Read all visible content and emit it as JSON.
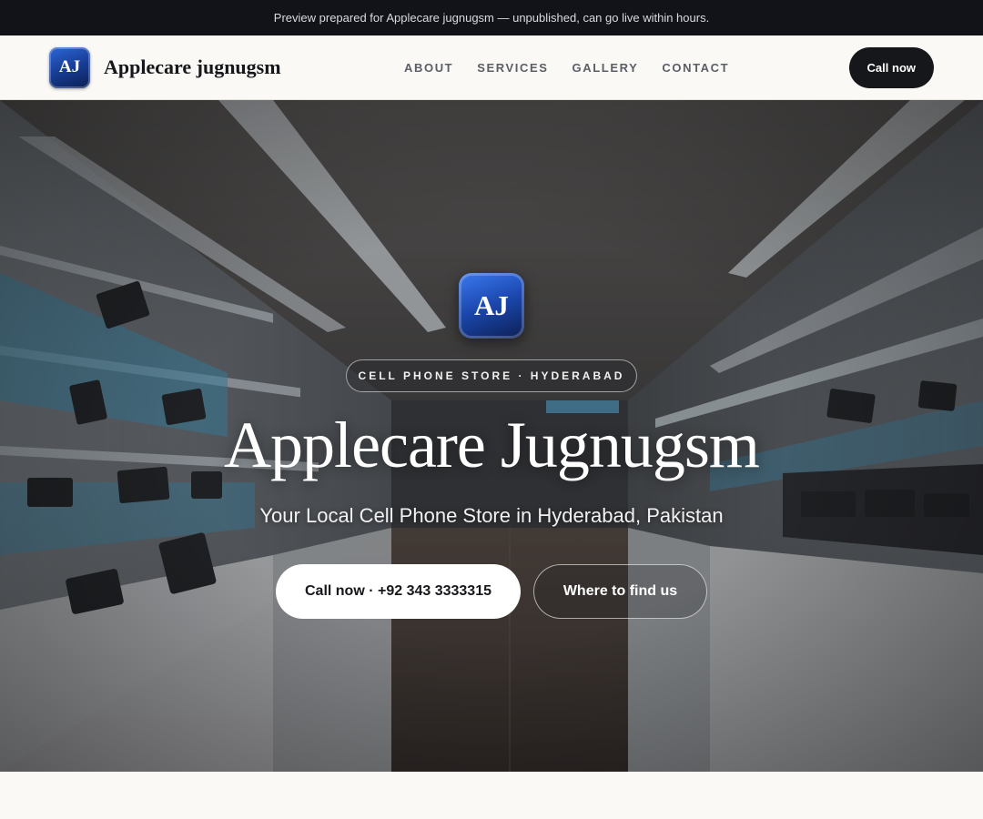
{
  "banner": {
    "text": "Preview prepared for Applecare jugnugsm — unpublished, can go live within hours."
  },
  "header": {
    "logo_text": "AJ",
    "brand_name": "Applecare jugnugsm",
    "nav": [
      {
        "label": "ABOUT"
      },
      {
        "label": "SERVICES"
      },
      {
        "label": "GALLERY"
      },
      {
        "label": "CONTACT"
      }
    ],
    "cta_label": "Call now"
  },
  "hero": {
    "logo_text": "AJ",
    "badge": "CELL PHONE STORE · HYDERABAD",
    "title": "Applecare Jugnugsm",
    "subtitle": "Your Local Cell Phone Store in Hyderabad, Pakistan",
    "primary_button": "Call now · +92 343 3333315",
    "secondary_button": "Where to find us"
  },
  "colors": {
    "topbar": "#111318",
    "page_bg": "#faf9f6",
    "dark_button": "#16171b",
    "logo_blue": "#1b46ab",
    "shelf_accent": "#3fb0e0"
  },
  "icons": {
    "hero_background": "phone-store-interior-photo"
  }
}
